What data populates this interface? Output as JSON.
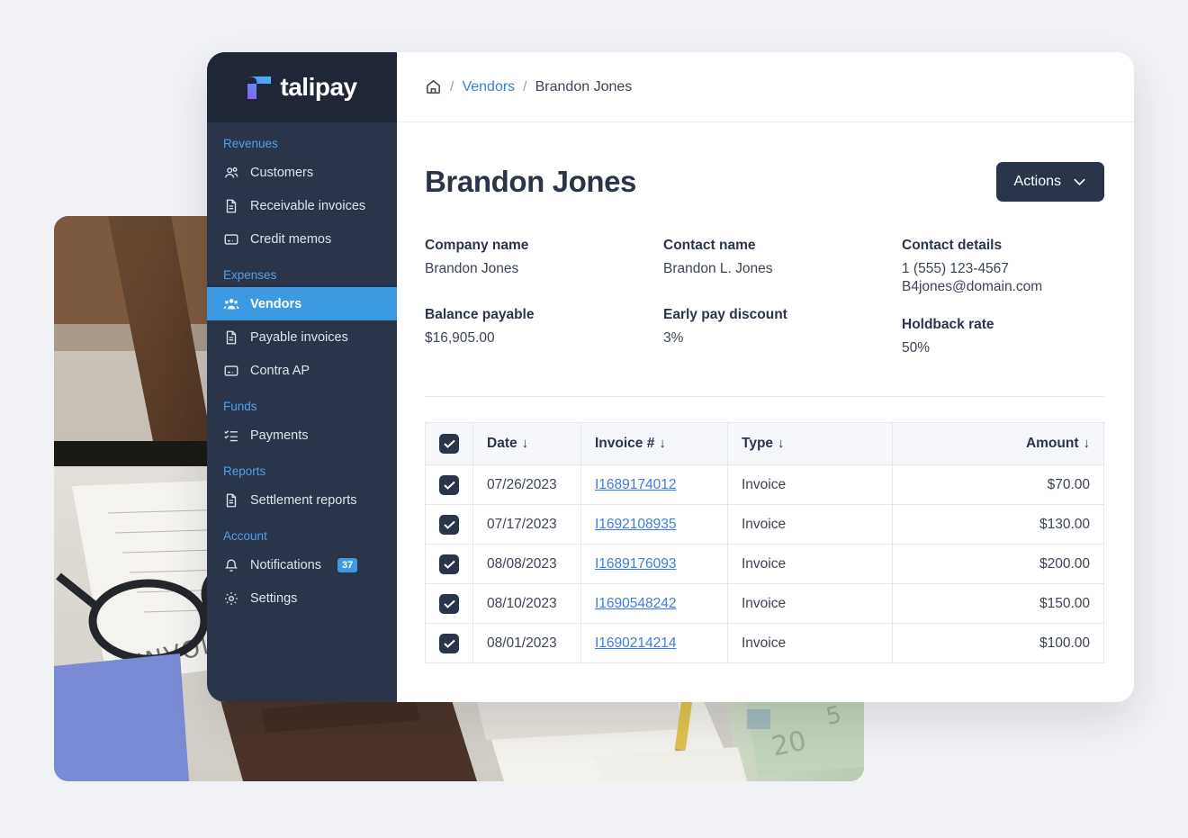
{
  "brand": {
    "name": "talipay",
    "logo_icon": "talipay-t-mark",
    "accent_blue": "#3b9ae1",
    "sidebar_bg": "#2b3549",
    "link_blue": "#3b7ddd"
  },
  "sidebar": {
    "groups": [
      {
        "title": "Revenues",
        "items": [
          {
            "label": "Customers",
            "icon": "users-icon",
            "active": false
          },
          {
            "label": "Receivable invoices",
            "icon": "document-icon",
            "active": false
          },
          {
            "label": "Credit memos",
            "icon": "card-icon",
            "active": false
          }
        ]
      },
      {
        "title": "Expenses",
        "items": [
          {
            "label": "Vendors",
            "icon": "users-group-icon",
            "active": true
          },
          {
            "label": "Payable invoices",
            "icon": "document-icon",
            "active": false
          },
          {
            "label": "Contra AP",
            "icon": "card-icon",
            "active": false
          }
        ]
      },
      {
        "title": "Funds",
        "items": [
          {
            "label": "Payments",
            "icon": "checklist-icon",
            "active": false
          }
        ]
      },
      {
        "title": "Reports",
        "items": [
          {
            "label": "Settlement reports",
            "icon": "document-icon",
            "active": false
          }
        ]
      },
      {
        "title": "Account",
        "items": [
          {
            "label": "Notifications",
            "icon": "bell-icon",
            "active": false,
            "badge": "37"
          },
          {
            "label": "Settings",
            "icon": "gear-icon",
            "active": false
          }
        ]
      }
    ]
  },
  "breadcrumb": {
    "home_icon": "home-icon",
    "sep": "/",
    "link": "Vendors",
    "current": "Brandon Jones"
  },
  "header": {
    "title": "Brandon Jones",
    "actions_label": "Actions",
    "actions_icon": "chevron-down-icon"
  },
  "details": [
    {
      "label": "Company name",
      "value": "Brandon Jones"
    },
    {
      "label": "Contact name",
      "value": "Brandon L. Jones"
    },
    {
      "label": "Contact details",
      "value": "1 (555) 123-4567\nB4jones@domain.com"
    },
    {
      "label": "Balance payable",
      "value": "$16,905.00"
    },
    {
      "label": "Early pay discount",
      "value": "3%"
    },
    {
      "label": "Holdback rate",
      "value": "50%"
    }
  ],
  "table": {
    "select_all_checked": true,
    "columns": [
      {
        "key": "date",
        "label": "Date",
        "sort_icon": "↓"
      },
      {
        "key": "invoice",
        "label": "Invoice #",
        "sort_icon": "↓"
      },
      {
        "key": "type",
        "label": "Type",
        "sort_icon": "↓"
      },
      {
        "key": "amount",
        "label": "Amount",
        "sort_icon": "↓"
      }
    ],
    "rows": [
      {
        "checked": true,
        "date": "07/26/2023",
        "invoice": "I1689174012",
        "type": "Invoice",
        "amount": "$70.00"
      },
      {
        "checked": true,
        "date": "07/17/2023",
        "invoice": "I1692108935",
        "type": "Invoice",
        "amount": "$130.00"
      },
      {
        "checked": true,
        "date": "08/08/2023",
        "invoice": "I1689176093",
        "type": "Invoice",
        "amount": "$200.00"
      },
      {
        "checked": true,
        "date": "08/10/2023",
        "invoice": "I1690548242",
        "type": "Invoice",
        "amount": "$150.00"
      },
      {
        "checked": true,
        "date": "08/01/2023",
        "invoice": "I1690214214",
        "type": "Invoice",
        "amount": "$100.00"
      }
    ]
  }
}
